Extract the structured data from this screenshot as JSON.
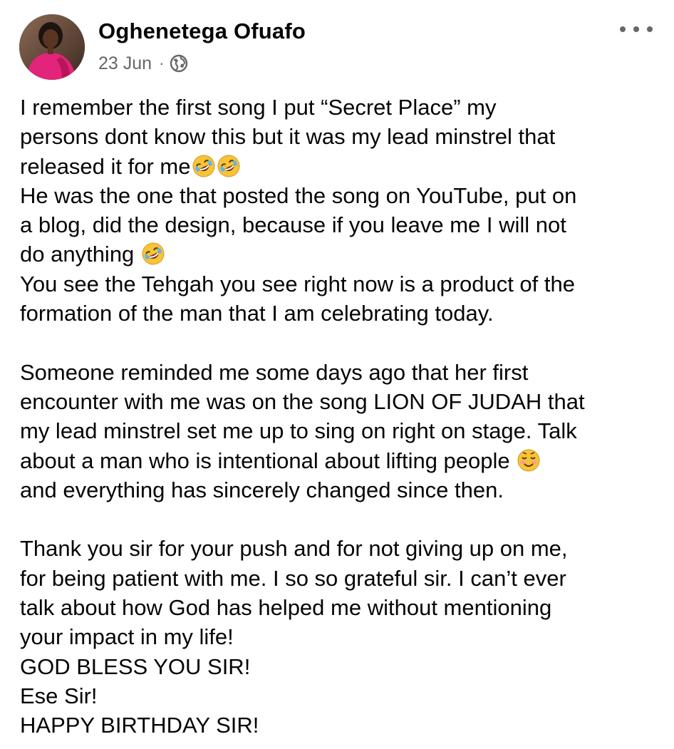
{
  "post": {
    "author": "Oghenetega Ofuafo",
    "date": "23 Jun",
    "separator": "·",
    "audience_icon": "globe-icon",
    "more_icon": "more-options-icon",
    "lines": [
      "I remember the first song I put “Secret Place” my",
      "persons dont know this but it was my lead minstrel that",
      "released it for me",
      "He was the one that posted the song on YouTube, put on",
      "a blog, did the design, because if you leave me I will not",
      "do anything ",
      "You see the Tehgah you see right now is a product of the",
      "formation of the man that I am celebrating today.",
      "Someone reminded me some days ago that her first",
      "encounter with me was on the song LION OF JUDAH that",
      "my lead minstrel set me up to sing on right on stage. Talk",
      "about a man who is intentional about lifting people ",
      "and everything has sincerely changed since then.",
      "Thank you sir for your push and for not giving up on me,",
      "for being patient with me. I so so grateful sir. I can’t ever",
      "talk about how God has helped me without mentioning",
      "your impact in my life!",
      "GOD BLESS YOU SIR!",
      "Ese Sir!",
      "HAPPY BIRTHDAY SIR!"
    ],
    "emoji_names": {
      "laughing": "rolling-on-floor-laughing-emoji",
      "smiling": "smiling-face-emoji"
    }
  },
  "colors": {
    "text": "#050505",
    "secondary_text": "#65676b",
    "emoji_yellow": "#f7c338",
    "avatar_dress": "#e2247a"
  }
}
